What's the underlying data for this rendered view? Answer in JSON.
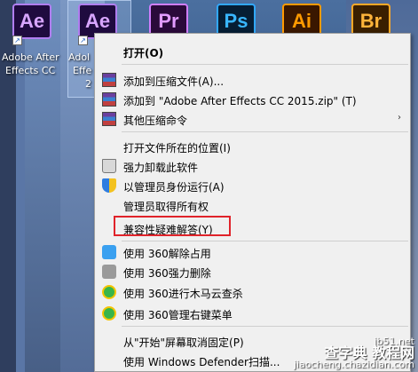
{
  "desktop": {
    "icons": [
      {
        "text": "Ae"
      },
      {
        "text": "Ae"
      },
      {
        "text": "Pr"
      },
      {
        "text": "Ps"
      },
      {
        "text": "Ai"
      },
      {
        "text": "Br"
      }
    ],
    "label_1_line1": "Adobe After",
    "label_1_line2": "Effects CC",
    "label_2_line1": "Adol",
    "label_2_line2": "Effe",
    "label_2_line3": "2"
  },
  "menu": {
    "items": [
      {
        "label": "打开(O)"
      },
      {
        "label": "添加到压缩文件(A)..."
      },
      {
        "label": "添加到 \"Adobe After Effects CC 2015.zip\" (T)"
      },
      {
        "label": "其他压缩命令"
      },
      {
        "label": "打开文件所在的位置(I)"
      },
      {
        "label": "强力卸载此软件"
      },
      {
        "label": "以管理员身份运行(A)"
      },
      {
        "label": "管理员取得所有权"
      },
      {
        "label": "兼容性疑难解答(Y)"
      },
      {
        "label": "使用 360解除占用"
      },
      {
        "label": "使用 360强力删除"
      },
      {
        "label": "使用 360进行木马云查杀"
      },
      {
        "label": "使用 360管理右键菜单"
      },
      {
        "label": "从\"开始\"屏幕取消固定(P)"
      },
      {
        "label": "使用 Windows Defender扫描..."
      }
    ],
    "submenu_arrow": "›"
  },
  "watermark": {
    "line1": "jb51.net",
    "line2": "查字典 教程网",
    "line3": "jiaocheng.chazidian.com"
  }
}
